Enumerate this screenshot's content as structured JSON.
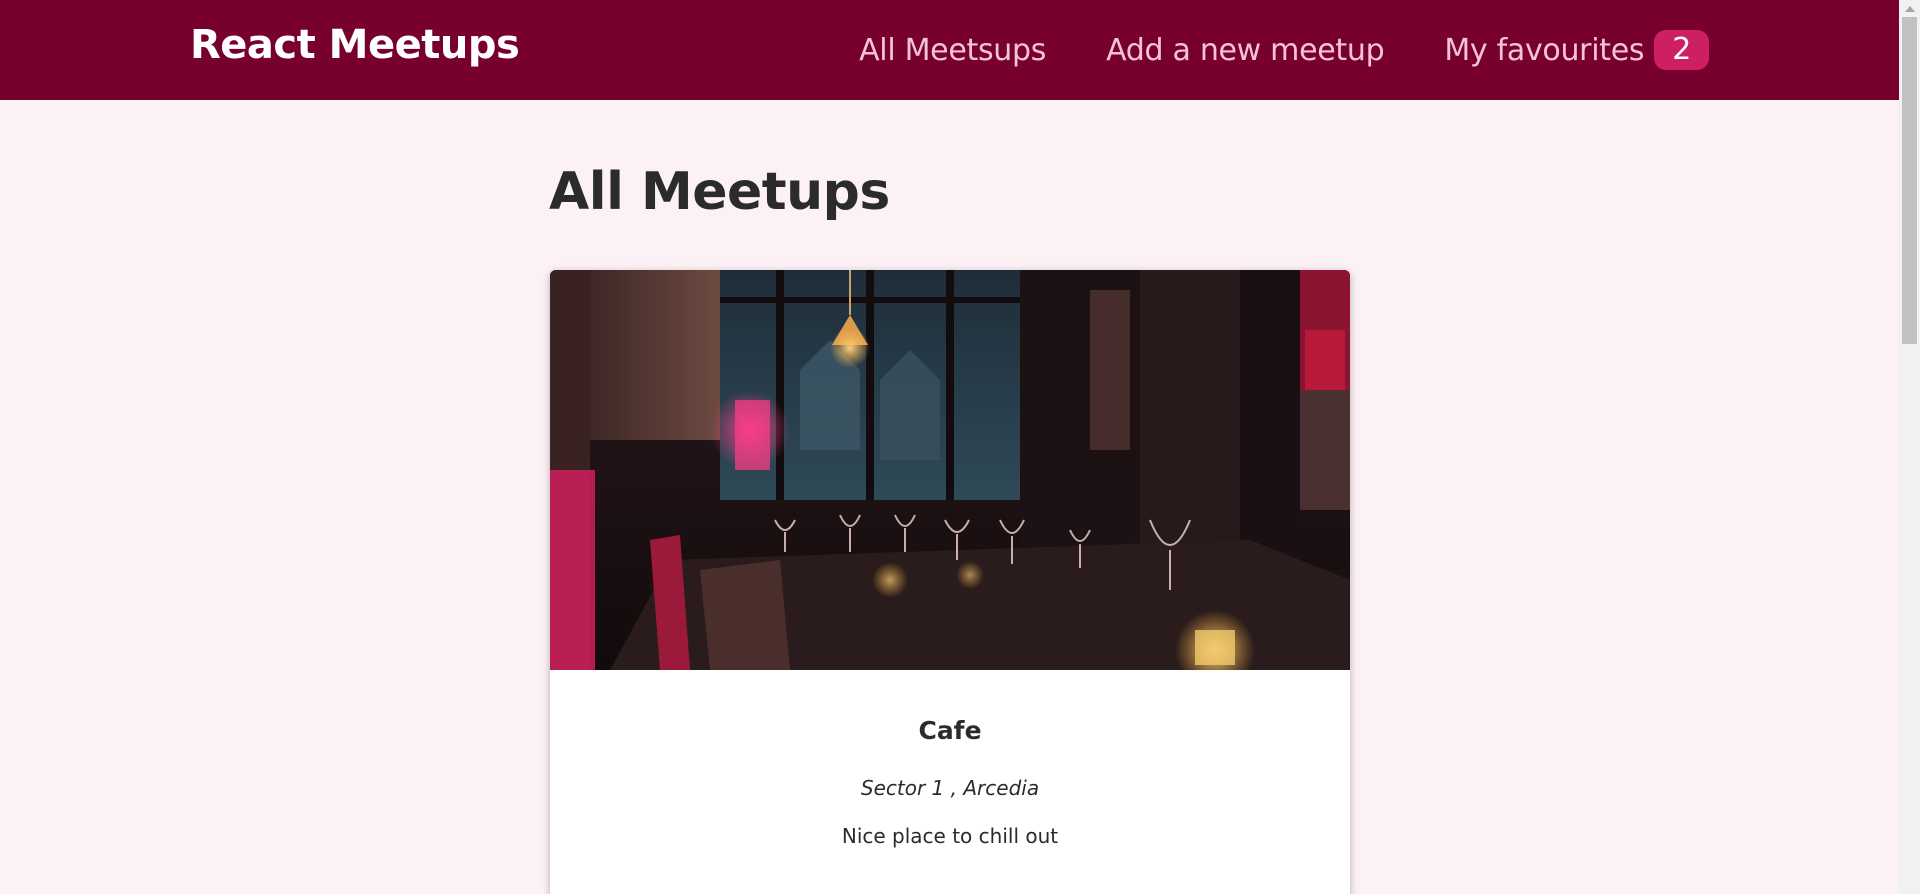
{
  "header": {
    "logo": "React Meetups",
    "nav": [
      {
        "label": "All Meetsups"
      },
      {
        "label": "Add a new meetup"
      },
      {
        "label": "My favourites",
        "badge": "2"
      }
    ]
  },
  "main": {
    "title": "All Meetups",
    "meetups": [
      {
        "title": "Cafe",
        "address": "Sector 1 , Arcedia",
        "description": "Nice place to chill out"
      }
    ]
  },
  "colors": {
    "header_bg": "#77002e",
    "page_bg": "#fcf1f5",
    "badge_bg": "#cc2062",
    "nav_text": "#f4c3d6"
  }
}
